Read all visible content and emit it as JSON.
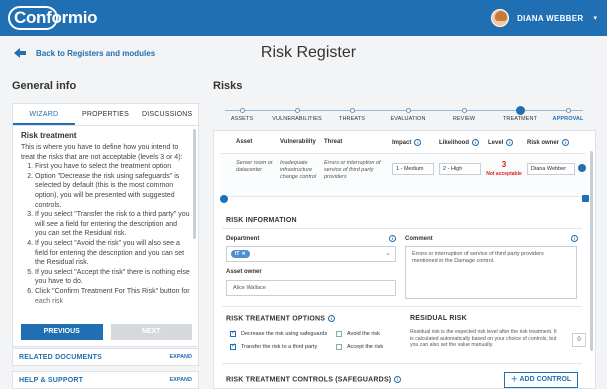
{
  "app": {
    "name": "Conformio",
    "user": "DIANA WEBBER"
  },
  "header": {
    "back_label": "Back to Registers and modules",
    "page_title": "Risk Register"
  },
  "left": {
    "title": "General info",
    "tabs": [
      "WIZARD",
      "PROPERTIES",
      "DISCUSSIONS"
    ],
    "wizard_title": "Risk treatment",
    "wizard_intro": "This is where you have to define how you intend to treat the risks that are not acceptable (levels 3 or 4):",
    "wizard_steps": [
      "First you have to select the treatment option",
      "Option \"Decrease the risk using safeguards\" is selected by default (this is the most common option), you will be presented with suggested controls.",
      "If you select \"Transfer the risk to a third party\" you will see a field for entering the description and you can set the Residual risk.",
      "If you select \"Avoid the risk\" you will also see a field for entering the description and you can set the Residual risk.",
      "If you select \"Accept the risk\" there is nothing else you have to do.",
      "Click \"Confirm Treatment For This Risk\" button for each risk"
    ],
    "btn_previous": "PREVIOUS",
    "btn_next": "NEXT",
    "related_documents": "RELATED DOCUMENTS",
    "help_support": "HELP & SUPPORT",
    "expand": "EXPAND"
  },
  "right": {
    "title": "Risks",
    "steps": [
      "ASSETS",
      "VULNERABILITIES",
      "THREATS",
      "EVALUATION",
      "REVIEW",
      "TREATMENT",
      "APPROVAL"
    ],
    "columns": {
      "asset": "Asset",
      "vulnerability": "Vulnerability",
      "threat": "Threat",
      "impact": "Impact",
      "likelihood": "Likelihood",
      "level": "Level",
      "owner": "Risk owner"
    },
    "row": {
      "asset": "Server room or datacenter",
      "vulnerability": "Inadequate infrastructure change control",
      "threat": "Errors or interruption of service of third party providers",
      "impact": "1 - Medium",
      "likelihood": "2 - High",
      "level": "3",
      "level_text": "Not acceptable",
      "owner": "Diana Webber"
    },
    "risk_info": {
      "title": "RISK INFORMATION",
      "department_label": "Department",
      "department_chip": "IT",
      "comment_label": "Comment",
      "comment": "Errors or interruption of service of third party providers mentioned in the Damage control.",
      "asset_owner_label": "Asset owner",
      "asset_owner": "Alice Wallace"
    },
    "treatment": {
      "title": "RISK TREATMENT OPTIONS",
      "opt_decrease": "Decrease the risk using safeguards",
      "opt_transfer": "Transfer the risk to a third party",
      "opt_avoid": "Avoid the risk",
      "opt_accept": "Accept the risk",
      "residual_title": "RESIDUAL RISK",
      "residual_text": "Residual risk is the expected risk level after the risk treatment. It is calculated automatically based on your choice of controls, but you can also set the value manually.",
      "residual_value": "0"
    },
    "controls": {
      "title": "RISK TREATMENT CONTROLS (SAFEGUARDS)",
      "add_label": "ADD CONTROL"
    }
  }
}
